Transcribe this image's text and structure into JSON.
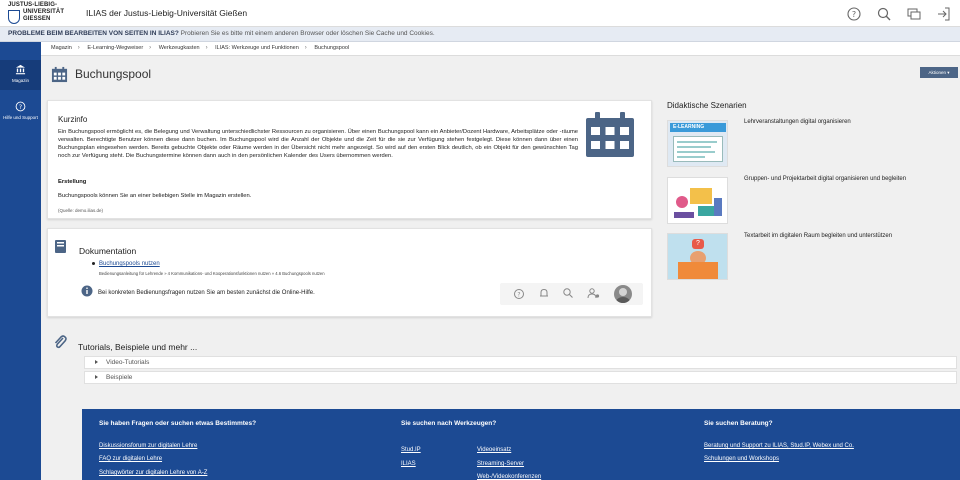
{
  "header": {
    "logo_line1": "JUSTUS-LIEBIG-",
    "logo_line2": "UNIVERSITÄT",
    "logo_line3": "GIESSEN",
    "title": "ILIAS der Justus-Liebig-Universität Gießen",
    "icons": [
      "help-circle-icon",
      "search-icon",
      "notifications-icon",
      "logout-icon"
    ]
  },
  "alert": {
    "bold": "PROBLEME BEIM BEARBEITEN VON SEITEN IN ILIAS?",
    "text": "Probieren Sie es bitte mit einem anderen Browser oder löschen Sie Cache und Cookies."
  },
  "sidebar": {
    "items": [
      {
        "label": "Magazin",
        "icon": "bank-icon"
      },
      {
        "label": "Hilfe und Support",
        "icon": "help-icon"
      }
    ]
  },
  "breadcrumb": [
    "Magazin",
    "E-Learning-Wegweiser",
    "Werkzeugkasten",
    "ILIAS: Werkzeuge und Funktionen",
    "Buchungspool"
  ],
  "page": {
    "title": "Buchungspool",
    "actions_label": "Aktionen"
  },
  "kurzinfo": {
    "heading": "Kurzinfo",
    "paragraph": "Ein Buchungspool ermöglicht es, die Belegung und Verwaltung unterschiedlichster Ressourcen zu organisieren. Über einen Buchungspool kann ein Anbieter/Dozent Hardware, Arbeitsplätze oder -räume verwalten. Berechtigte Benutzer können diese dann buchen. Im Buchungspool wird die Anzahl der Objekte und die Zeit für die sie zur Verfügung stehen festgelegt. Diese können dann über einen Buchungsplan eingesehen werden. Bereits gebuchte Objekte oder Räume werden in der Übersicht nicht mehr angezeigt. So wird auf den ersten Blick deutlich, ob ein Objekt für den gewünschten Tag noch zur Verfügung steht. Die Buchungstermine können dann auch in den persönlichen Kalender des Users übernommen werden.",
    "subheading": "Erstellung",
    "paragraph2": "Buchungspools können Sie an einer beliebigen Stelle im Magazin erstellen.",
    "source": "(Quelle: demo.ilias.de)"
  },
  "dokumentation": {
    "heading": "Dokumentation",
    "link": "Buchungspools nutzen",
    "path": "Bedienungsanleitung für Lehrende » 4 Kommunikations- und Kooperationsfunktionen nutzen » 4.6 Buchungspools nutzen",
    "info": "Bei konkreten Bedienungsfragen nutzen Sie am besten zunächst die Online-Hilfe."
  },
  "tutorials": {
    "heading": "Tutorials, Beispiele und mehr ...",
    "items": [
      "Video-Tutorials",
      "Beispiele"
    ]
  },
  "didaktik": {
    "heading": "Didaktische Szenarien",
    "items": [
      {
        "text": "Lehrveranstaltungen digital organisieren",
        "image_label": "E-LEARNING"
      },
      {
        "text": "Gruppen- und Projektarbeit digital organisieren und begleiten"
      },
      {
        "text": "Textarbeit im digitalen Raum begleiten und unterstützen"
      }
    ]
  },
  "footer": {
    "col1": {
      "heading": "Sie haben Fragen oder suchen etwas Bestimmtes?",
      "links": [
        "Diskussionsforum zur digitalen Lehre",
        "FAQ zur digitalen Lehre",
        "Schlagwörter zur digitalen Lehre von A-Z"
      ]
    },
    "col2": {
      "heading": "Sie suchen nach Werkzeugen?",
      "links_a": [
        "Stud.IP",
        "ILIAS"
      ],
      "links_b": [
        "Videoeinsatz",
        "Streaming-Server",
        "Web-/Videokonferenzen"
      ]
    },
    "col3": {
      "heading": "Sie suchen Beratung?",
      "links": [
        "Beratung und Support zu ILIAS, Stud.IP, Webex und Co.",
        "Schulungen und Workshops"
      ]
    }
  },
  "colors": {
    "brand_blue": "#1c4a93",
    "alert_bg": "#e6ebf3",
    "page_bg": "#f0f0f0",
    "actions_bg": "#4c6586"
  }
}
